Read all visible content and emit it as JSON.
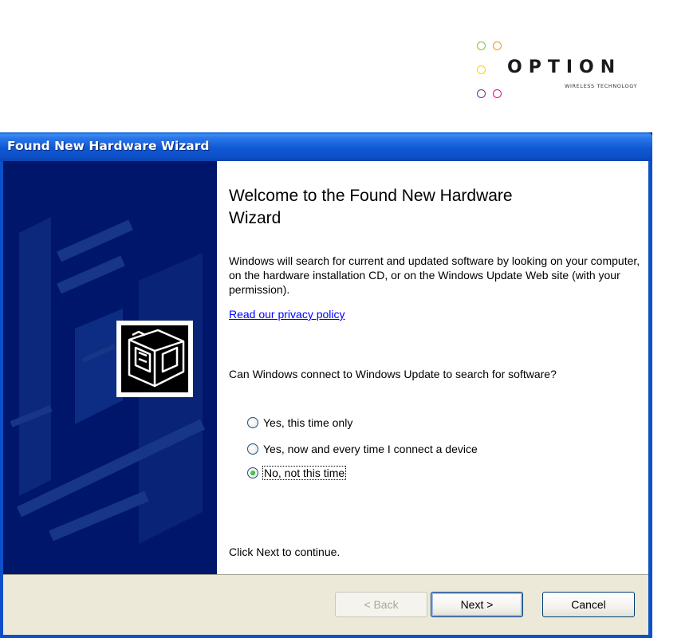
{
  "brand": {
    "name": "OPTION",
    "tagline": "WIRELESS TECHNOLOGY",
    "ring_colors": [
      "#7dc242",
      "#f7941d",
      "#00aeef",
      "#ec008c",
      "#8dc63f",
      "#fff200",
      "#662d91",
      "#ed1c24"
    ]
  },
  "window": {
    "title": "Found New Hardware Wizard",
    "icon": "hardware-card-icon"
  },
  "content": {
    "heading": "Welcome to the Found New Hardware Wizard",
    "intro": "Windows will search for current and updated software by looking on your computer, on the hardware installation CD, or on the Windows Update Web site (with your permission).",
    "privacy_link": "Read our privacy policy",
    "question": "Can Windows connect to Windows Update to search for software?",
    "options": [
      {
        "label": "Yes, this time only",
        "checked": false
      },
      {
        "label": "Yes, now and every time I connect a device",
        "checked": false
      },
      {
        "label": "No, not this time",
        "checked": true
      }
    ],
    "footer": "Click Next to continue."
  },
  "buttons": {
    "back": "< Back",
    "next": "Next >",
    "cancel": "Cancel"
  },
  "colors": {
    "titlebar": "#0c56cf",
    "banner": "#00166b",
    "button_bar": "#ece9d8",
    "link": "#0000ff"
  }
}
